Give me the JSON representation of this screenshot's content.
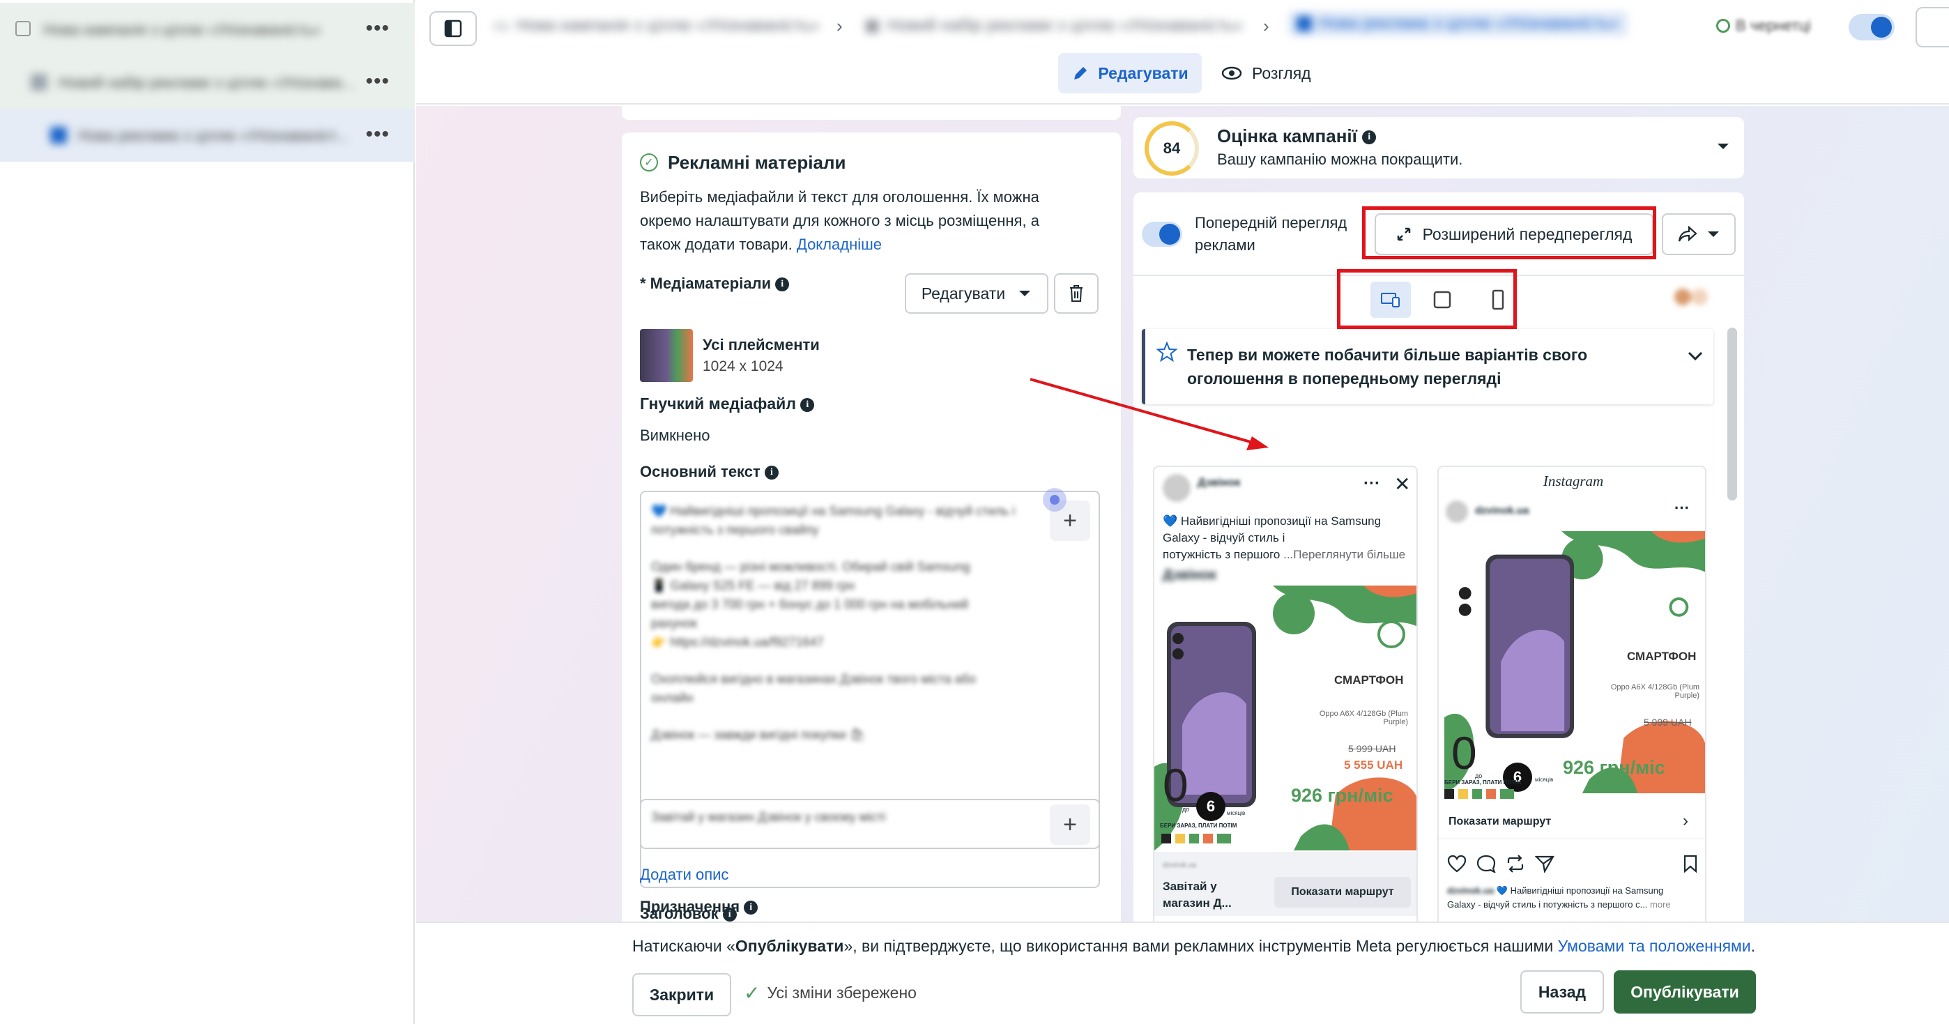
{
  "tree": {
    "items": [
      {
        "label": "Нова кампанія з ціллю «Упізнаваність»"
      },
      {
        "label": "Новий набір реклами з ціллю «Упізнава..."
      },
      {
        "label": "Нова реклама з ціллю «Упізнаваніст..."
      }
    ],
    "more": "•••"
  },
  "topbar": {
    "crumb_campaign": "Нова кампанія з ціллю «Упізнаваність»",
    "crumb_adset": "Новий набір реклами з ціллю «Упізнаваність»",
    "crumb_ad": "Нова реклама з ціллю «Упізнаваність»",
    "sep": "›",
    "status": "В чернетці",
    "edit_tab": "Редагувати",
    "view_tab": "Розгляд"
  },
  "creative": {
    "title": "Рекламні матеріали",
    "desc_1": "Виберіть медіафайли й текст для оголошення. Їх можна",
    "desc_2": "окремо налаштувати для кожного з місць розміщення, а",
    "desc_3": "також додати товари.",
    "learn_more": "Докладніше",
    "media_label": "* Медіаматеріали",
    "edit_btn": "Редагувати",
    "placements_title": "Усі плейсменти",
    "placements_size": "1024 x 1024",
    "flexible_label": "Гнучкий медіафайл",
    "flexible_value": "Вимкнено",
    "primary_text_label": "Основний текст",
    "primary_text_lines": [
      "💙 Найвигідніші пропозиції на Samsung Galaxy - відчуй стиль і",
      "потужність з першого свайпу",
      "Один бренд — різні можливості. Обирай свій Samsung",
      "📱 Galaxy S25 FE — від 27 899 грн",
      "вигода до 3 700 грн + бонус до 1 000 грн на мобільний",
      "рахунок",
      "👉 https://dzvinok.ua/f9271647",
      "Охоплюйся вигідно в магазинах Дзвінок твого міста або",
      "онлайн",
      "Дзвінок — завжди вигідні покупки 🛍"
    ],
    "headline_label": "Заголовок",
    "headline_value": "Завітай у магазин Дзвінок у своєму місті",
    "add_description": "Додати опис",
    "destination_label": "Призначення"
  },
  "score": {
    "value": "84",
    "title": "Оцінка кампанії",
    "subtitle": "Вашу кампанію можна покращити."
  },
  "preview": {
    "toggle_label_1": "Попередній перегляд",
    "toggle_label_2": "реклами",
    "advanced_btn": "Розширений передперегляд",
    "banner_line_1": "Тепер ви можете побачити більше варіантів свого",
    "banner_line_2": "оголошення в попередньому перегляді",
    "fb": {
      "page_name": "Дзвінок",
      "text_1": "💙 Найвигідніші пропозиції на Samsung",
      "text_2": "Galaxy - відчуй стиль і",
      "text_3": "потужність з першого",
      "see_more": "...Переглянути більше",
      "sponsor": "Дзвінок",
      "cta_title_1": "Завітай у",
      "cta_title_2": "магазин Д...",
      "cta_btn": "Показати маршрут"
    },
    "ig": {
      "brand": "Instagram",
      "account": "dzvinok.ua",
      "cta": "Показати маршрут",
      "caption_1": "💙 Найвигідніші пропозиції на Samsung",
      "caption_2": "Galaxy - відчуй стиль і потужність з першого с...",
      "more": "more"
    },
    "ad_image": {
      "title": "СМАРТФОН",
      "model_1": "Oppo A6X 4/128Gb (Plum",
      "model_2": "Purple)",
      "old_price": "5 999 UAH",
      "new_price": "5 555 UAH",
      "monthly": "926 грн/міс",
      "zero": "0",
      "six": "6",
      "do": "до",
      "months": "місяців",
      "buy_now": "БЕРИ ЗАРАЗ, ПЛАТИ ПОТІМ"
    }
  },
  "footer": {
    "notice_before": "Натискаючи «",
    "notice_bold": "Опублікувати",
    "notice_after": "», ви підтверджуєте, що використання вами рекламних інструментів Meta регулюється нашими",
    "terms_link": "Умовами та положеннями",
    "period": ".",
    "close_btn": "Закрити",
    "saved": "Усі зміни збережено",
    "back_btn": "Назад",
    "publish_btn": "Опублікувати"
  },
  "colors": {
    "accent": "#1b64c9",
    "publish": "#2f6b3d",
    "highlight": "#e0141b",
    "ad_green": "#4f9c5a",
    "ad_orange": "#e8744a"
  }
}
